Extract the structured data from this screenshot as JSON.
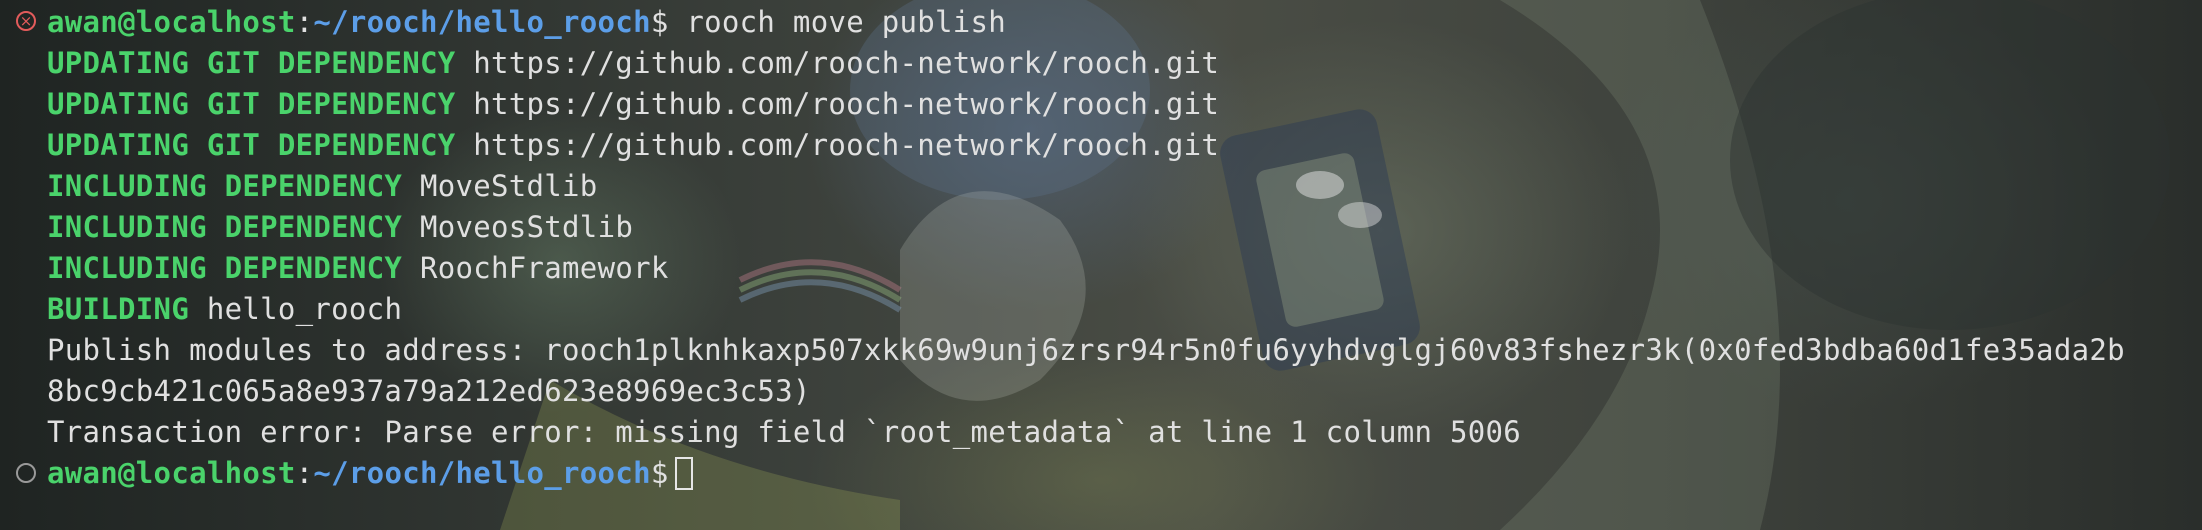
{
  "terminal": {
    "prompt": {
      "user_host": "awan@localhost",
      "separator": ":",
      "path": "~/rooch/hello_rooch",
      "symbol": "$"
    },
    "command": "rooch move publish",
    "output": [
      {
        "label": "UPDATING GIT DEPENDENCY",
        "text": "https://github.com/rooch-network/rooch.git"
      },
      {
        "label": "UPDATING GIT DEPENDENCY",
        "text": "https://github.com/rooch-network/rooch.git"
      },
      {
        "label": "UPDATING GIT DEPENDENCY",
        "text": "https://github.com/rooch-network/rooch.git"
      },
      {
        "label": "INCLUDING DEPENDENCY",
        "text": "MoveStdlib"
      },
      {
        "label": "INCLUDING DEPENDENCY",
        "text": "MoveosStdlib"
      },
      {
        "label": "INCLUDING DEPENDENCY",
        "text": "RoochFramework"
      },
      {
        "label": "BUILDING",
        "text": "hello_rooch"
      }
    ],
    "publish_line_1": "Publish modules to address: rooch1plknhkaxp507xkk69w9unj6zrsr94r5n0fu6yyhdvglgj60v83fshezr3k(0x0fed3bdba60d1fe35ada2b",
    "publish_line_2": "8bc9cb421c065a8e937a79a212ed623e8969ec3c53)",
    "error_line": "Transaction error: Parse error: missing field `root_metadata` at line 1 column 5006",
    "error_marker_symbol": "×",
    "colors": {
      "green": "#4ad36b",
      "blue": "#5c9ee8",
      "text": "#e0e0e0",
      "error": "#e25b5b"
    }
  }
}
